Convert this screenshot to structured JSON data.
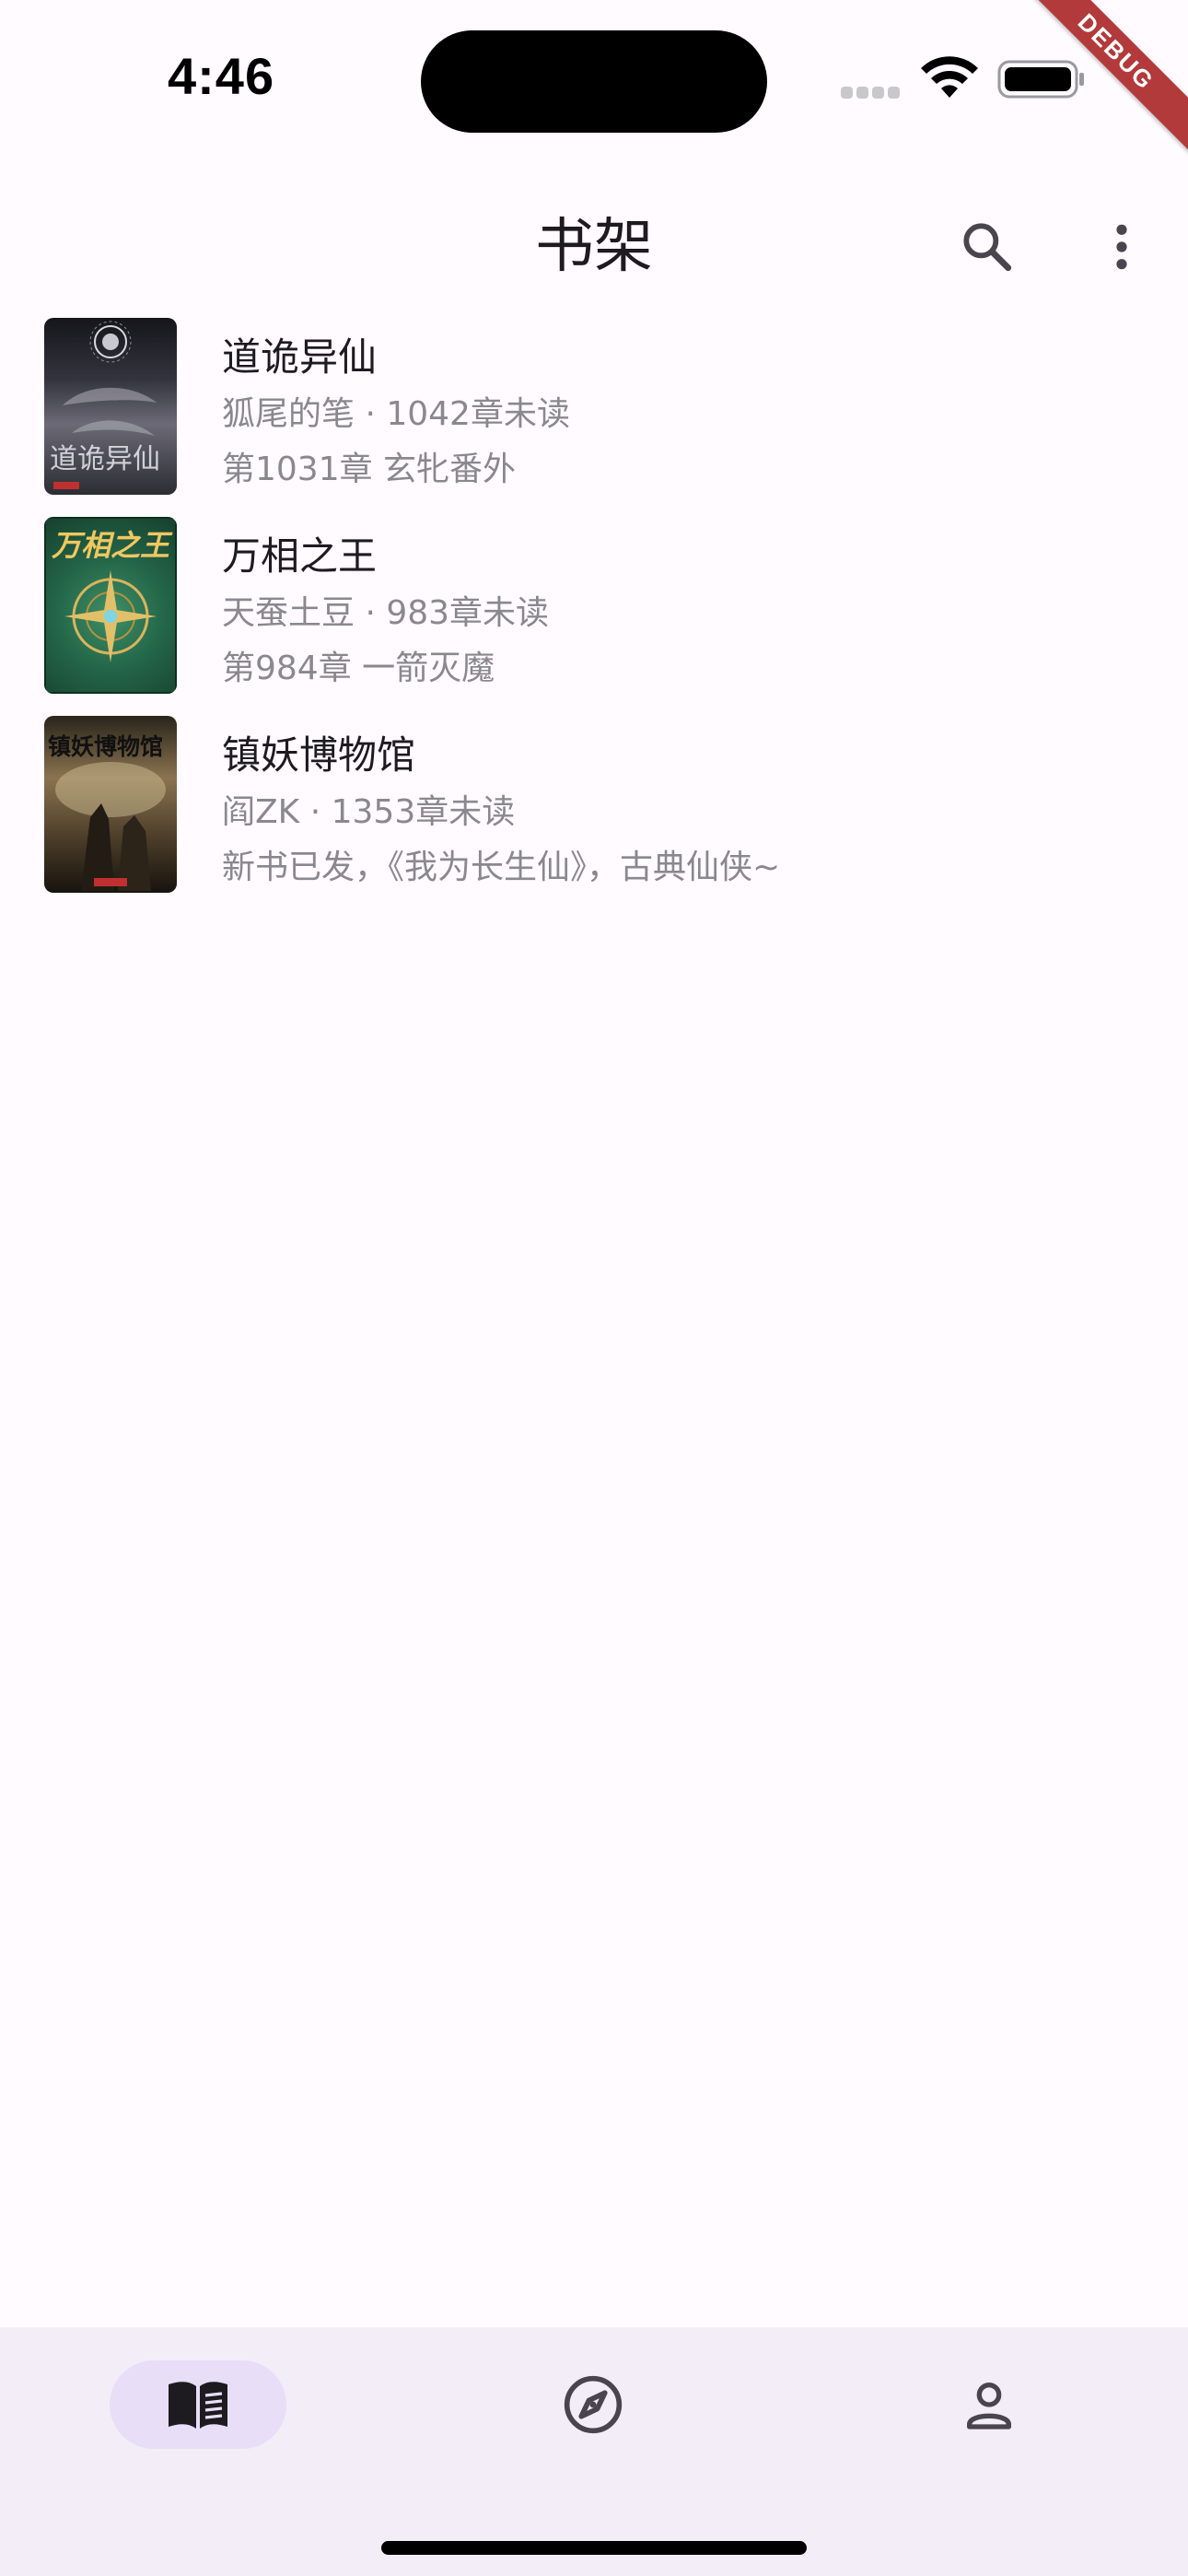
{
  "status_bar": {
    "time": "4:46"
  },
  "debug_banner": "DEBUG",
  "app_bar": {
    "title": "书架",
    "actions": [
      "search-icon",
      "more-vert-icon"
    ]
  },
  "books": [
    {
      "title": "道诡异仙",
      "author": "狐尾的笔",
      "unread": "1042章未读",
      "meta": "狐尾的笔 · 1042章未读",
      "latest_chapter": "第1031章 玄牝番外",
      "cover_text": "道诡异仙",
      "cover_colors": [
        "#1c1c24",
        "#5a5a66",
        "#9a98a4"
      ]
    },
    {
      "title": "万相之王",
      "author": "天蚕土豆",
      "unread": "983章未读",
      "meta": "天蚕土豆 · 983章未读",
      "latest_chapter": "第984章 一箭灭魔",
      "cover_text": "万相之王",
      "cover_colors": [
        "#1f5a3c",
        "#2f7a52",
        "#d6b25a"
      ]
    },
    {
      "title": "镇妖博物馆",
      "author": "阎ZK",
      "unread": "1353章未读",
      "meta": "阎ZK · 1353章未读",
      "latest_chapter": "新书已发，《我为长生仙》，古典仙侠~",
      "cover_text": "镇妖博物馆",
      "cover_colors": [
        "#1a1712",
        "#6e5a3e",
        "#c9b48a"
      ]
    }
  ],
  "bottom_nav": {
    "items": [
      {
        "icon": "book-icon",
        "active": true
      },
      {
        "icon": "compass-icon",
        "active": false
      },
      {
        "icon": "person-icon",
        "active": false
      }
    ]
  },
  "colors": {
    "background": "#fffbfe",
    "nav_background": "#f3edf7",
    "nav_active_pill": "#e8def8",
    "primary_text": "#1d1b20",
    "secondary_text": "#8a888f",
    "icon": "#49454f",
    "debug_banner": "#b33a3a"
  }
}
